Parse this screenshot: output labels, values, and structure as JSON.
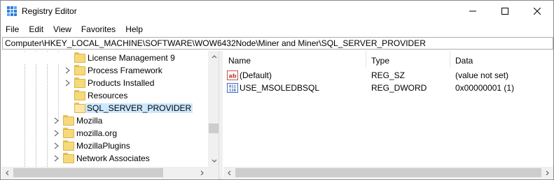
{
  "window": {
    "title": "Registry Editor",
    "icon": "registry-editor-icon",
    "controls": [
      "minimize-icon",
      "maximize-icon",
      "close-icon"
    ]
  },
  "menu": {
    "items": [
      {
        "label": "File"
      },
      {
        "label": "Edit"
      },
      {
        "label": "View"
      },
      {
        "label": "Favorites"
      },
      {
        "label": "Help"
      }
    ]
  },
  "address": {
    "path": "Computer\\HKEY_LOCAL_MACHINE\\SOFTWARE\\WOW6432Node\\Miner and Miner\\SQL_SERVER_PROVIDER"
  },
  "tree": {
    "items": [
      {
        "label": "License Management 9",
        "expandable": false,
        "selected": false,
        "level": 2
      },
      {
        "label": "Process Framework",
        "expandable": true,
        "selected": false,
        "level": 2
      },
      {
        "label": "Products Installed",
        "expandable": true,
        "selected": false,
        "level": 2
      },
      {
        "label": "Resources",
        "expandable": false,
        "selected": false,
        "level": 2
      },
      {
        "label": "SQL_SERVER_PROVIDER",
        "expandable": false,
        "selected": true,
        "level": 2
      },
      {
        "label": "Mozilla",
        "expandable": true,
        "selected": false,
        "level": 1
      },
      {
        "label": "mozilla.org",
        "expandable": true,
        "selected": false,
        "level": 1
      },
      {
        "label": "MozillaPlugins",
        "expandable": true,
        "selected": false,
        "level": 1
      },
      {
        "label": "Network Associates",
        "expandable": true,
        "selected": false,
        "level": 1
      }
    ]
  },
  "values": {
    "columns": {
      "name": "Name",
      "type": "Type",
      "data": "Data"
    },
    "rows": [
      {
        "icon": "string-value-icon",
        "name": "(Default)",
        "type": "REG_SZ",
        "data": "(value not set)"
      },
      {
        "icon": "binary-value-icon",
        "name": "USE_MSOLEDBSQL",
        "type": "REG_DWORD",
        "data": "0x00000001 (1)"
      }
    ]
  },
  "colors": {
    "selection": "#cce8ff",
    "folder": "#f6d979",
    "scrollbar_track": "#f0f0f0",
    "scrollbar_thumb": "#cdcdcd"
  }
}
